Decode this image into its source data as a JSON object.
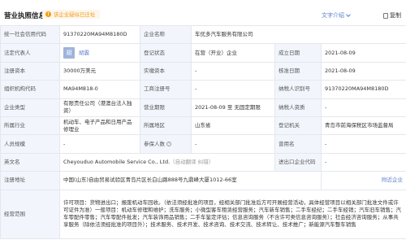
{
  "header": {
    "title": "营业执照信息",
    "notice": "该企业疑似已迁址",
    "text_intro": "文字介绍",
    "copy": "复制"
  },
  "rows": {
    "credit_code": {
      "label": "统一社会信用代码",
      "value": "91370220MA94M8180D"
    },
    "company_name": {
      "label": "企业名称",
      "value": "车优多汽车服务有限公司"
    },
    "legal_rep": {
      "label": "法定代表人",
      "avatar": "胡",
      "value": "胡震"
    },
    "reg_status": {
      "label": "登记状态",
      "value": "在营（开业）企业"
    },
    "est_date": {
      "label": "成立日期",
      "value": "2021-08-09"
    },
    "reg_capital": {
      "label": "注册资本",
      "value": "30000万美元"
    },
    "paid_capital": {
      "label": "实缴资本",
      "value": "-"
    },
    "approve_date": {
      "label": "核准日期",
      "value": "2021-08-09"
    },
    "org_code": {
      "label": "组织机构代码",
      "value": "MA94M818-0"
    },
    "biz_reg_no": {
      "label": "工商注册号",
      "value": "-"
    },
    "taxpayer_id": {
      "label": "纳税人识别号",
      "value": "91370220MA94M8180D"
    },
    "ent_type": {
      "label": "企业类型",
      "value": "有限责任公司（港澳台法人独资）"
    },
    "biz_term": {
      "label": "营业期限",
      "value": "2021-08-09 至 无固定期限"
    },
    "taxpayer_qual": {
      "label": "纳税人资质",
      "value": "-"
    },
    "industry": {
      "label": "所属行业",
      "value": "机动车、电子产品和日用产品修理业"
    },
    "region": {
      "label": "所属地区",
      "value": "山东省"
    },
    "reg_authority": {
      "label": "登记机关",
      "value": "青岛市前海保税区市场监督局"
    },
    "staff_size": {
      "label": "人员规模",
      "value": "-"
    },
    "insured": {
      "label": "参保人数",
      "value": "-"
    },
    "former_name": {
      "label": "曾用名",
      "value": "-"
    },
    "en_name": {
      "label": "英文名",
      "value": "Cheyouduo Automobile Service Co., Ltd.",
      "note": "（自动翻译 纠错）"
    },
    "import_export": {
      "label": "进出口企业代码",
      "value": "-"
    },
    "reg_address": {
      "label": "注册地址",
      "value": "中国(山东)自由贸易试验区青岛片区长白山路888号九鼎峰大厦1012-66室",
      "nearby": "附近企业"
    },
    "biz_scope": {
      "label": "经营范围",
      "value": "许可项目：货物进出口；报废机动车回收。（依法须经批准的项目，经相关部门批准后方可开展经营活动，具体经营项目以相关部门批准文件或许可证件为准）一般项目：机动车修理和维护；洗车服务；小微型客车租赁经营服务；汽车新车销售；二手车经纪；二手车经销；汽车旧车销售；汽车零配件零售；汽车零配件批发；汽车装饰用品销售；二手车鉴定评估；信息咨询服务（不含许可类信息咨询服务）；社会经济咨询服务；从事共享服务（除依法须经批准的项目外）；技术服务、技术开发、技术咨询、技术交流、技术转让、技术推广；新能源汽车整车销售"
    }
  }
}
